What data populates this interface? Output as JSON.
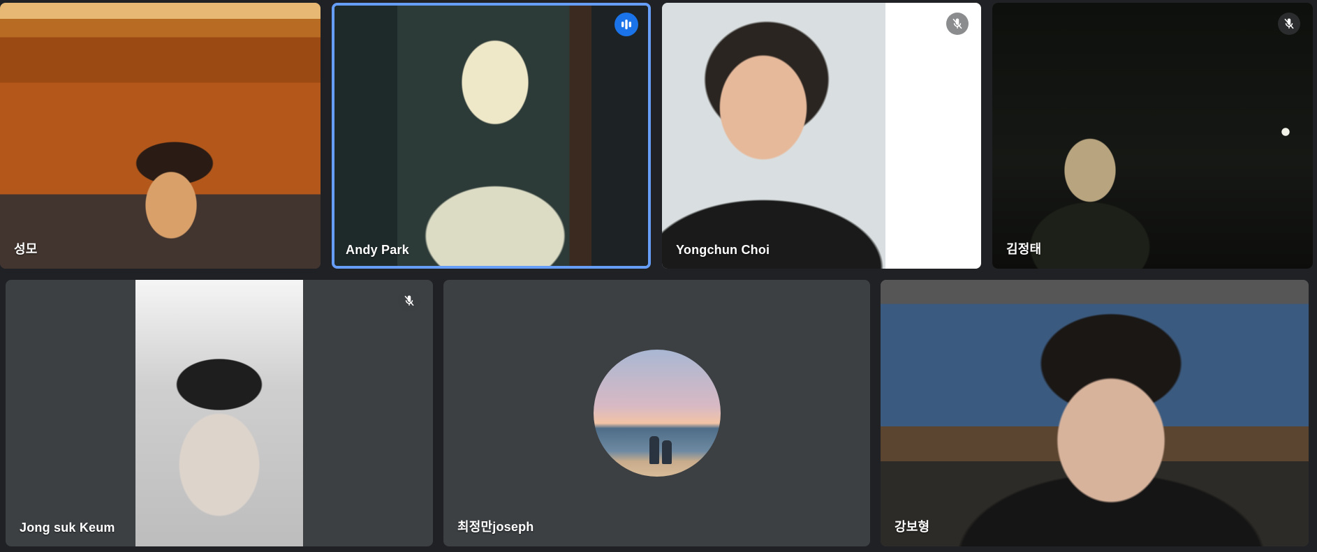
{
  "meeting": {
    "participants": [
      {
        "name": "성모",
        "mic_muted": false,
        "speaking": false
      },
      {
        "name": "Andy Park",
        "mic_muted": false,
        "speaking": true
      },
      {
        "name": "Yongchun Choi",
        "mic_muted": true,
        "speaking": false
      },
      {
        "name": "김정태",
        "mic_muted": true,
        "speaking": false
      },
      {
        "name": "Jong suk Keum",
        "mic_muted": true,
        "speaking": false
      },
      {
        "name": "최정만joseph",
        "mic_muted": false,
        "speaking": false,
        "camera_off": true
      },
      {
        "name": "강보형",
        "mic_muted": false,
        "speaking": false
      }
    ]
  },
  "colors": {
    "background": "#202124",
    "tile": "#3c4043",
    "speaking_border": "#669df6",
    "speaking_badge": "#1a73e8"
  },
  "icons": {
    "mic_off": "mic-off-icon",
    "speaking": "audio-level-icon"
  }
}
